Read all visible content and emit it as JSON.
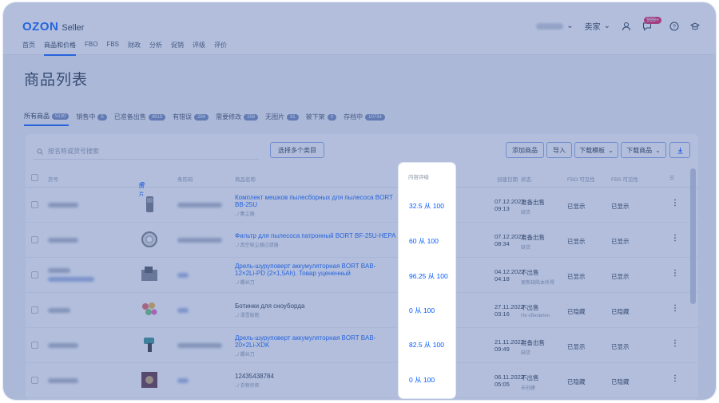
{
  "header": {
    "logo_text": "OZON",
    "logo_sub": "Seller",
    "lang": "卖家",
    "notif_badge": "999+"
  },
  "nav": [
    "首页",
    "商品和价格",
    "FBO",
    "FBS",
    "财政",
    "分析",
    "促销",
    "评级",
    "评价"
  ],
  "page_title": "商品列表",
  "tabs": [
    {
      "label": "所有商品",
      "count": "5130"
    },
    {
      "label": "销售中",
      "count": "5"
    },
    {
      "label": "已准备出售",
      "count": "4919"
    },
    {
      "label": "有错误",
      "count": "294"
    },
    {
      "label": "需要修改",
      "count": "258"
    },
    {
      "label": "无图片",
      "count": "91"
    },
    {
      "label": "被下架",
      "count": "0"
    },
    {
      "label": "存档中",
      "count": "10734"
    }
  ],
  "toolbar": {
    "search_placeholder": "按名称或货号搜索",
    "select_categories": "选择多个类目",
    "add_product": "添加商品",
    "import": "导入",
    "download_template": "下载模板",
    "download_products": "下载商品"
  },
  "columns": {
    "sku": "货号",
    "image": "图片",
    "ozon_id": "条形码",
    "name": "商品名称",
    "content_rating": "内容评级",
    "created": "创建日期",
    "status": "状态",
    "fbo": "FBO 可见性",
    "fbs": "FBS 可见性"
  },
  "rows": [
    {
      "name": "Комплект мешков пылесборных для пылесоса BORT BB-25U",
      "cat": "../ 集尘器",
      "rating": "32.5 从 100",
      "date": "07.12.2022",
      "time": "09:13",
      "status": "准备出售",
      "status_sub": "缺货",
      "fbo": "已显示",
      "fbs": "已显示"
    },
    {
      "name": "Фильтр для пылесоса патронный BORT BF-25U-HEPA",
      "cat": "../ 真空吸尘器过滤器",
      "rating": "60 从 100",
      "date": "07.12.2022",
      "time": "08:34",
      "status": "准备出售",
      "status_sub": "缺货",
      "fbo": "已显示",
      "fbs": "已显示"
    },
    {
      "name": "Дрель-шуруповерт аккумуляторная BORT BAB-12×2Li-PD (2×1,5Ah). Товар уцененный",
      "cat": "../ 螺丝刀",
      "rating": "96.25 从 100",
      "date": "04.12.2022",
      "time": "04:18",
      "status": "不出售",
      "status_sub": "更新缺陷本所得",
      "fbo": "已显示",
      "fbs": "已显示"
    },
    {
      "name": "Ботинки для сноуборда",
      "cat": "../ 滑雪板靴",
      "rating": "0 从 100",
      "date": "27.11.2022",
      "time": "03:16",
      "status": "不出售",
      "status_sub": "Не обновлен",
      "fbo": "已隐藏",
      "fbs": "已隐藏"
    },
    {
      "name": "Дрель-шуруповерт аккумуляторная BORT BAB-20×2Li-XDK",
      "cat": "../ 螺丝刀",
      "rating": "82.5 从 100",
      "date": "21.11.2022",
      "time": "09:49",
      "status": "准备出售",
      "status_sub": "缺货",
      "fbo": "已显示",
      "fbs": "已显示"
    },
    {
      "name": "12435438784",
      "cat": "../ 衣物吊柜",
      "rating": "0 从 100",
      "date": "06.11.2022",
      "time": "05:05",
      "status": "不出售",
      "status_sub": "未创建",
      "fbo": "已隐藏",
      "fbs": "已隐藏"
    }
  ]
}
